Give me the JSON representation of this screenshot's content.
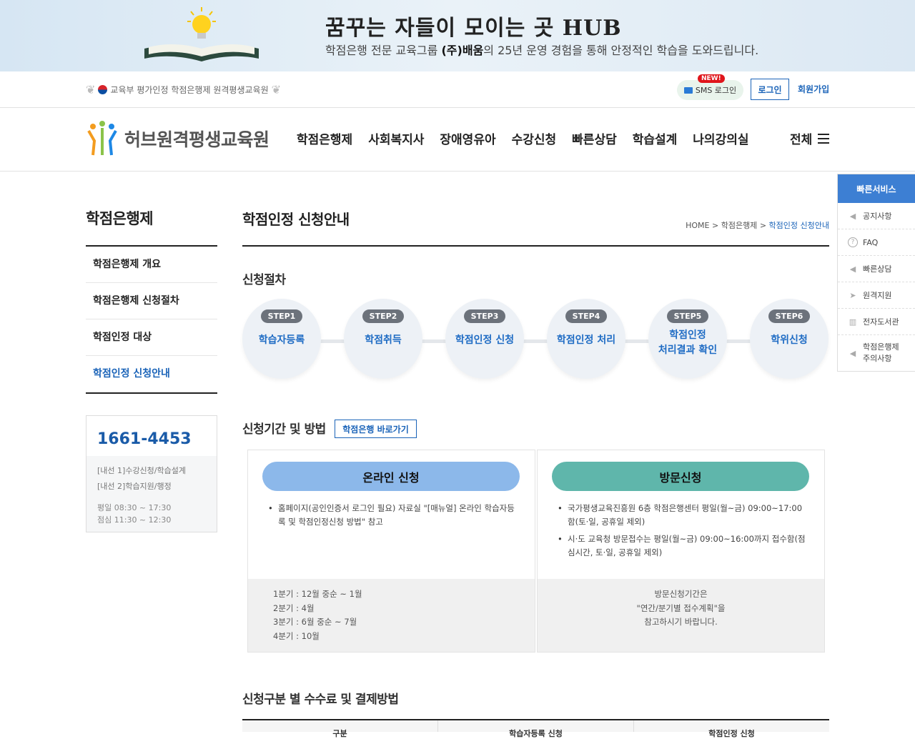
{
  "banner": {
    "tagline": "꿈꾸는 자들이 모이는 곳 HUB",
    "desc_pre": "학점은행 전문 교육그룹 ",
    "desc_brand": "(주)배움",
    "desc_post": "의 25년 운영 경험을 통해 안정적인 학습을 도와드립니다."
  },
  "utility": {
    "cert_text": "교육부 평가인정 학점은행제 원격평생교육원",
    "sms_label": "SMS 로그인",
    "new_badge": "NEW!",
    "login_label": "로그인",
    "join_label": "회원가입"
  },
  "header": {
    "logo_text": "허브원격평생교육원",
    "nav": [
      "학점은행제",
      "사회복지사",
      "장애영유아",
      "수강신청",
      "빠른상담",
      "학습설계",
      "나의강의실"
    ],
    "all_menu_label": "전체"
  },
  "sidebar": {
    "title": "학점은행제",
    "items": [
      {
        "label": "학점은행제 개요"
      },
      {
        "label": "학점은행제 신청절차"
      },
      {
        "label": "학점인정 대상"
      },
      {
        "label": "학점인정 신청안내"
      }
    ],
    "active_index": 3,
    "cs": {
      "phone": "1661-4453",
      "line1": "[내선 1]수강신청/학습설계",
      "line2": "[내선 2]학습지원/행정",
      "hours1": "평일 08:30 ~ 17:30",
      "hours2": "점심 11:30 ~ 12:30"
    }
  },
  "main": {
    "page_title": "학점인정 신청안내",
    "breadcrumb": {
      "home": "HOME",
      "parent": "학점은행제",
      "current": "학점인정 신청안내",
      "sep": ">"
    },
    "procedure_title": "신청절차",
    "steps": [
      {
        "tag": "STEP1",
        "label1": "학습자등록",
        "label2": ""
      },
      {
        "tag": "STEP2",
        "label1": "학점취득",
        "label2": ""
      },
      {
        "tag": "STEP3",
        "label1": "학점인정 신청",
        "label2": ""
      },
      {
        "tag": "STEP4",
        "label1": "학점인정 처리",
        "label2": ""
      },
      {
        "tag": "STEP5",
        "label1": "학점인정",
        "label2": "처리결과 확인"
      },
      {
        "tag": "STEP6",
        "label1": "학위신청",
        "label2": ""
      }
    ],
    "period_title": "신청기간 및 방법",
    "bank_link_label": "학점은행 바로가기",
    "online": {
      "title": "온라인 신청",
      "color": "#8cb8ea",
      "bullets": [
        "홈페이지(공인인증서 로그인 필요) 자료실 \"[매뉴얼] 온라인 학습자등록 및 학점인정신청 방법\" 참고"
      ],
      "foot": [
        "1분기 : 12월 중순 ~ 1월",
        "2분기 : 4월",
        "3분기 : 6월 중순 ~ 7월",
        "4분기 : 10월"
      ]
    },
    "visit": {
      "title": "방문신청",
      "color": "#5fb6ab",
      "bullets": [
        "국가평생교육진흥원 6층 학점은행센터 평일(월~금) 09:00~17:00함(토·일, 공휴일 제외)",
        "시·도 교육청 방문접수는 평일(월~금) 09:00~16:00까지 접수함(점심시간, 토·일, 공휴일 제외)"
      ],
      "foot": [
        "방문신청기간은",
        "\"연간/분기별 접수계획\"을",
        "참고하시기 바랍니다."
      ]
    },
    "fee_title": "신청구분 별 수수료 및 결제방법",
    "fee_headers": [
      "구분",
      "학습자등록 신청",
      "학점인정 신청"
    ]
  },
  "quick": {
    "title": "빠른서비스",
    "items": [
      {
        "icon": "speaker-icon",
        "label": "공지사항"
      },
      {
        "icon": "question-icon",
        "label": "FAQ"
      },
      {
        "icon": "speaker-icon",
        "label": "빠른상담"
      },
      {
        "icon": "cursor-icon",
        "label": "원격지원"
      },
      {
        "icon": "library-icon",
        "label": "전자도서관"
      },
      {
        "icon": "speaker-icon",
        "label": "학점은행제 주의사항"
      }
    ]
  }
}
